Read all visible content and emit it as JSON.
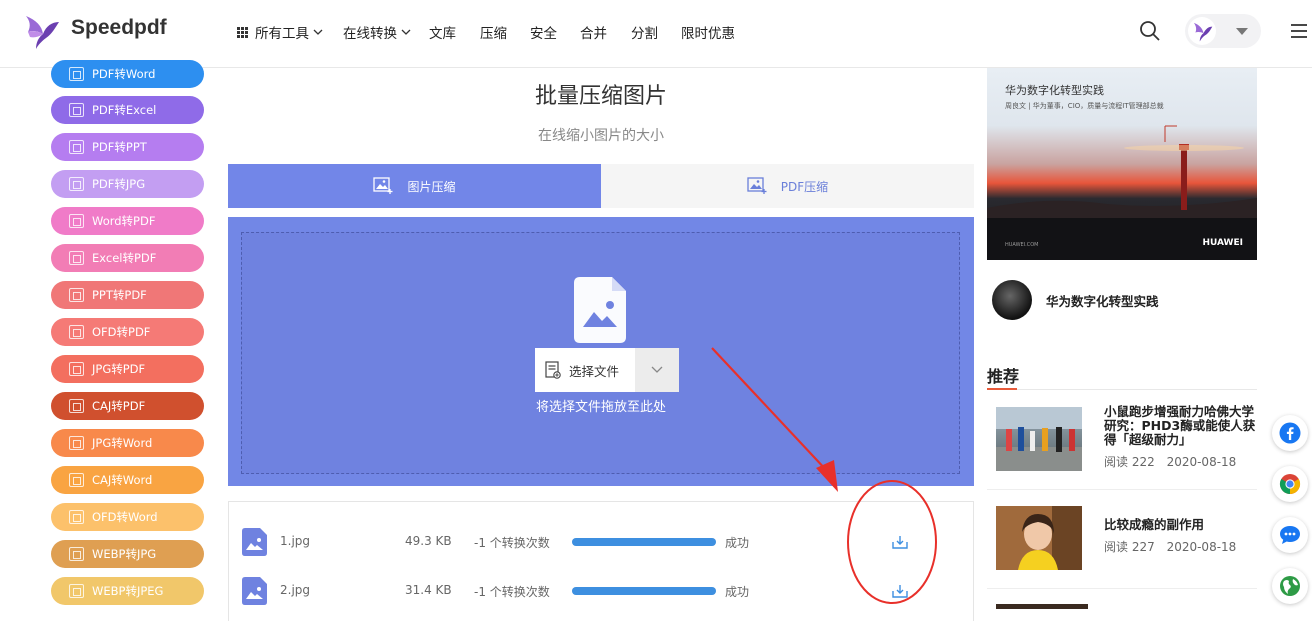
{
  "brand": {
    "name": "Speedpdf"
  },
  "nav": {
    "items": [
      {
        "label": "所有工具",
        "dropdown": true
      },
      {
        "label": "在线转换",
        "dropdown": true
      },
      {
        "label": "文库",
        "dropdown": false
      },
      {
        "label": "压缩",
        "dropdown": false
      },
      {
        "label": "安全",
        "dropdown": false
      },
      {
        "label": "合并",
        "dropdown": false
      },
      {
        "label": "分割",
        "dropdown": false
      },
      {
        "label": "限时优惠",
        "dropdown": false
      }
    ]
  },
  "sidebar": {
    "items": [
      {
        "label": "PDF转Word",
        "color": "#2d8ff0"
      },
      {
        "label": "PDF转Excel",
        "color": "#8f6be8"
      },
      {
        "label": "PDF转PPT",
        "color": "#b57df0"
      },
      {
        "label": "PDF转JPG",
        "color": "#c39ef2"
      },
      {
        "label": "Word转PDF",
        "color": "#f07bc8"
      },
      {
        "label": "Excel转PDF",
        "color": "#f27db5"
      },
      {
        "label": "PPT转PDF",
        "color": "#f07777"
      },
      {
        "label": "OFD转PDF",
        "color": "#f57a76"
      },
      {
        "label": "JPG转PDF",
        "color": "#f36f5f"
      },
      {
        "label": "CAJ转PDF",
        "color": "#d0502e"
      },
      {
        "label": "JPG转Word",
        "color": "#f8894b"
      },
      {
        "label": "CAJ转Word",
        "color": "#f9a442"
      },
      {
        "label": "OFD转Word",
        "color": "#fcc16b"
      },
      {
        "label": "WEBP转JPG",
        "color": "#df9f52"
      },
      {
        "label": "WEBP转JPEG",
        "color": "#f1c76a"
      }
    ]
  },
  "main": {
    "title": "批量压缩图片",
    "subtitle": "在线缩小图片的大小",
    "tabs": [
      {
        "label": "图片压缩",
        "active": true
      },
      {
        "label": "PDF压缩",
        "active": false
      }
    ],
    "choose_button": "选择文件",
    "drop_hint": "将选择文件拖放至此处",
    "files": [
      {
        "name": "1.jpg",
        "size": "49.3 KB",
        "count": "-1 个转换次数",
        "progress": 1.0,
        "status": "成功"
      },
      {
        "name": "2.jpg",
        "size": "31.4 KB",
        "count": "-1 个转换次数",
        "progress": 1.0,
        "status": "成功"
      }
    ]
  },
  "ad": {
    "title": "华为数字化转型实践",
    "subtitle": "周良文 | 华为董事，CIO，质量与流程IT管理部总裁",
    "brand": "HUAWEI",
    "small": "HUAWEI.COM"
  },
  "author": {
    "name": "华为数字化转型实践"
  },
  "recommend": {
    "heading": "推荐",
    "items": [
      {
        "title": "小鼠跑步增强耐力哈佛大学研究：PHD3酶或能使人获得「超级耐力」",
        "reads": "阅读 222",
        "date": "2020-08-18"
      },
      {
        "title": "比较成瘾的副作用",
        "reads": "阅读 227",
        "date": "2020-08-18"
      }
    ]
  },
  "social": [
    "facebook-icon",
    "chrome-icon",
    "chat-icon",
    "globe-icon"
  ],
  "colors": {
    "accent": "#7286e8",
    "progress": "#3d8fe0",
    "annotation": "#e8302a"
  }
}
